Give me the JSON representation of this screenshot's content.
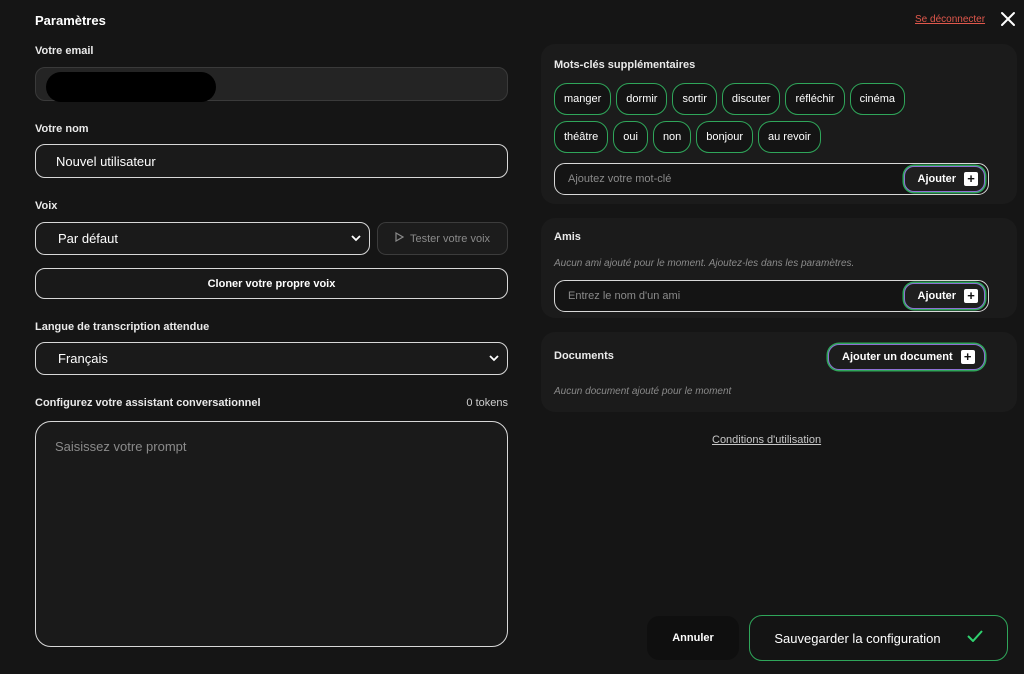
{
  "header": {
    "title": "Paramètres",
    "logout_label": "Se déconnecter",
    "close_icon": "close-icon"
  },
  "email": {
    "label": "Votre email",
    "value": ""
  },
  "name": {
    "label": "Votre nom",
    "value": "Nouvel utilisateur"
  },
  "voice": {
    "label": "Voix",
    "selected": "Par défaut",
    "test_label": "Tester votre voix",
    "clone_label": "Cloner votre propre voix"
  },
  "language": {
    "label": "Langue de transcription attendue",
    "selected": "Français"
  },
  "assistant": {
    "label": "Configurez votre assistant conversationnel",
    "tokens": "0 tokens",
    "placeholder": "Saisissez votre prompt"
  },
  "keywords": {
    "label": "Mots-clés supplémentaires",
    "chips": [
      "manger",
      "dormir",
      "sortir",
      "discuter",
      "réfléchir",
      "cinéma",
      "théâtre",
      "oui",
      "non",
      "bonjour",
      "au revoir"
    ],
    "placeholder": "Ajoutez votre mot-clé",
    "add_label": "Ajouter"
  },
  "friends": {
    "label": "Amis",
    "empty": "Aucun ami ajouté pour le moment. Ajoutez-les dans les paramètres.",
    "placeholder": "Entrez le nom d'un ami",
    "add_label": "Ajouter"
  },
  "documents": {
    "label": "Documents",
    "add_label": "Ajouter un document",
    "empty": "Aucun document ajouté pour le moment"
  },
  "terms_label": "Conditions d'utilisation",
  "footer": {
    "cancel_label": "Annuler",
    "save_label": "Sauvegarder la configuration"
  },
  "colors": {
    "accent_green": "#2fa65a",
    "accent_purple": "#8e70d4",
    "logout_red": "#e0584c"
  }
}
